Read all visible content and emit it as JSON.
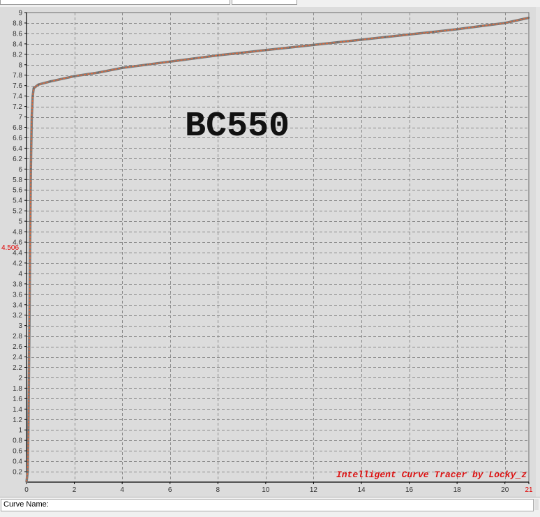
{
  "status": {
    "curve_name_label": "Curve Name:"
  },
  "chart_data": {
    "type": "line",
    "title": "BC550",
    "watermark": "Intelligent Curve Tracer by Locky_z",
    "xlim": [
      0,
      21
    ],
    "ylim": [
      0,
      9
    ],
    "x_ticks": [
      "0",
      "2",
      "4",
      "6",
      "8",
      "10",
      "12",
      "14",
      "16",
      "18",
      "20",
      "21"
    ],
    "x_tick_values": [
      0,
      2,
      4,
      6,
      8,
      10,
      12,
      14,
      16,
      18,
      20,
      21
    ],
    "y_tick_values": [
      0.2,
      0.4,
      0.6,
      0.8,
      1,
      1.2,
      1.4,
      1.6,
      1.8,
      2,
      2.2,
      2.4,
      2.6,
      2.8,
      3,
      3.2,
      3.4,
      3.6,
      3.8,
      4,
      4.2,
      4.4,
      4.6,
      4.8,
      5,
      5.2,
      5.4,
      5.6,
      5.8,
      6,
      6.2,
      6.4,
      6.6,
      6.8,
      7,
      7.2,
      7.4,
      7.6,
      7.8,
      8,
      8.2,
      8.4,
      8.6,
      8.8,
      9
    ],
    "y_ticks": [
      "0.2",
      "0.4",
      "0.6",
      "0.8",
      "1",
      "1.2",
      "1.4",
      "1.6",
      "1.8",
      "2",
      "2.2",
      "2.4",
      "2.6",
      "2.8",
      "3",
      "3.2",
      "3.4",
      "3.6",
      "3.8",
      "4",
      "4.2",
      "4.4",
      "4.6",
      "4.8",
      "5",
      "5.2",
      "5.4",
      "5.6",
      "5.8",
      "6",
      "6.2",
      "6.4",
      "6.6",
      "6.8",
      "7",
      "7.2",
      "7.4",
      "7.6",
      "7.8",
      "8",
      "8.2",
      "8.4",
      "8.6",
      "8.8",
      "9"
    ],
    "grid": true,
    "cursor_y_label": "4.506",
    "cursor_x_label": "21",
    "series": [
      {
        "color": "#e06a3c",
        "points": [
          [
            0,
            0
          ],
          [
            0.05,
            0.2
          ],
          [
            0.08,
            1
          ],
          [
            0.1,
            2
          ],
          [
            0.12,
            3
          ],
          [
            0.14,
            4
          ],
          [
            0.16,
            5
          ],
          [
            0.18,
            6
          ],
          [
            0.22,
            7
          ],
          [
            0.26,
            7.4
          ],
          [
            0.3,
            7.55
          ],
          [
            0.5,
            7.62
          ],
          [
            1,
            7.68
          ],
          [
            2,
            7.78
          ],
          [
            3,
            7.85
          ],
          [
            4,
            7.94
          ],
          [
            5,
            8.0
          ],
          [
            6,
            8.06
          ],
          [
            7,
            8.12
          ],
          [
            8,
            8.18
          ],
          [
            9,
            8.23
          ],
          [
            10,
            8.28
          ],
          [
            11,
            8.33
          ],
          [
            12,
            8.38
          ],
          [
            13,
            8.43
          ],
          [
            14,
            8.48
          ],
          [
            15,
            8.53
          ],
          [
            16,
            8.58
          ],
          [
            17,
            8.63
          ],
          [
            18,
            8.68
          ],
          [
            19,
            8.74
          ],
          [
            20,
            8.8
          ],
          [
            21,
            8.9
          ]
        ]
      }
    ]
  }
}
